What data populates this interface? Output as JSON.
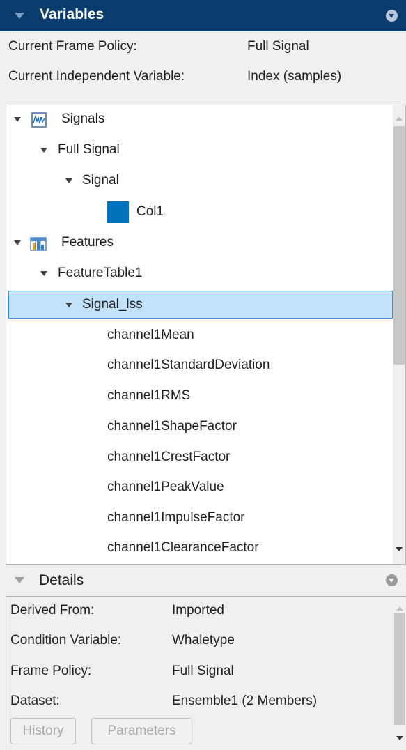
{
  "variables_panel": {
    "title": "Variables",
    "frame_policy_label": "Current Frame Policy:",
    "frame_policy_value": "Full Signal",
    "indep_var_label": "Current Independent Variable:",
    "indep_var_value": "Index (samples)"
  },
  "tree": {
    "signals": "Signals",
    "full_signal": "Full Signal",
    "signal": "Signal",
    "col1": "Col1",
    "col1_color": "#0072bd",
    "features": "Features",
    "feature_table": "FeatureTable1",
    "signal_lss": "Signal_lss",
    "features_list": [
      "channel1Mean",
      "channel1StandardDeviation",
      "channel1RMS",
      "channel1ShapeFactor",
      "channel1CrestFactor",
      "channel1PeakValue",
      "channel1ImpulseFactor",
      "channel1ClearanceFactor"
    ]
  },
  "details_panel": {
    "title": "Details",
    "rows": [
      {
        "label": "Derived From:",
        "value": "Imported"
      },
      {
        "label": "Condition Variable:",
        "value": "Whaletype"
      },
      {
        "label": "Frame Policy:",
        "value": "Full Signal"
      },
      {
        "label": "Dataset:",
        "value": "Ensemble1 (2 Members)"
      }
    ],
    "history_button": "History",
    "parameters_button": "Parameters"
  }
}
